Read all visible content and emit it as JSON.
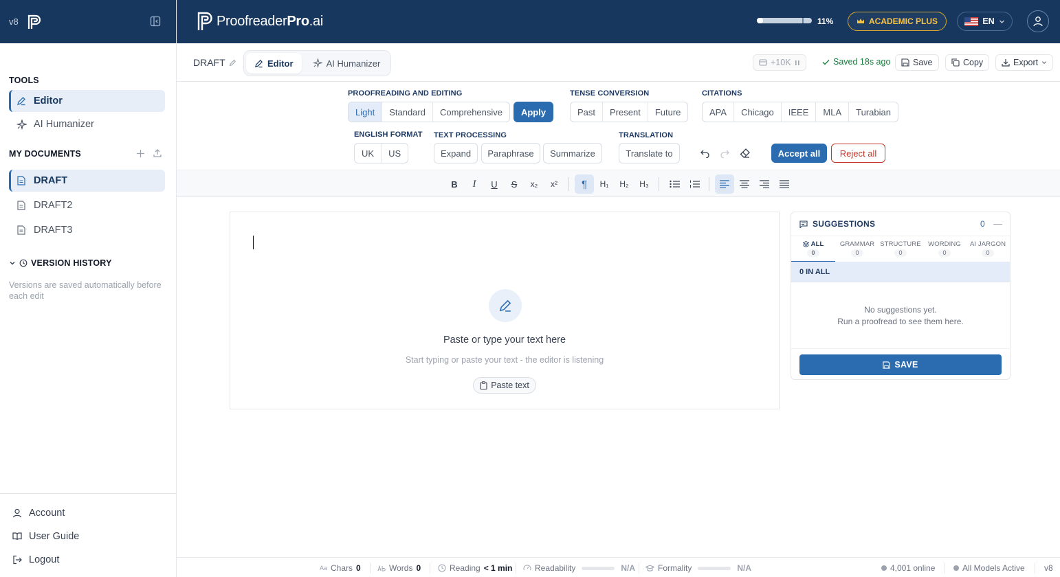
{
  "sidebar": {
    "version": "v8",
    "tools_title": "TOOLS",
    "tools": [
      {
        "label": "Editor",
        "icon": "pencil-icon"
      },
      {
        "label": "AI Humanizer",
        "icon": "sparkle-icon"
      }
    ],
    "docs_title": "MY DOCUMENTS",
    "documents": [
      {
        "label": "DRAFT"
      },
      {
        "label": "DRAFT2"
      },
      {
        "label": "DRAFT3"
      }
    ],
    "history_title": "VERSION HISTORY",
    "history_note": "Versions are saved automatically before each edit",
    "bottom_links": [
      {
        "label": "Account",
        "icon": "user-icon"
      },
      {
        "label": "User Guide",
        "icon": "book-icon"
      },
      {
        "label": "Logout",
        "icon": "logout-icon"
      }
    ]
  },
  "header": {
    "brand_light": "Proofreader",
    "brand_bold": "Pro",
    "brand_suffix": ".ai",
    "usage_percent": 11,
    "usage_label": "11%",
    "plan_label": "ACADEMIC PLUS",
    "language": "EN",
    "colors": {
      "navy": "#17375e",
      "accent": "#2b6cb0",
      "gold": "#f6c343"
    }
  },
  "docbar": {
    "doc_name": "DRAFT",
    "tabs": [
      {
        "label": "Editor",
        "icon": "pencil-icon"
      },
      {
        "label": "AI Humanizer",
        "icon": "sparkle-icon"
      }
    ],
    "tokens": "+10K",
    "saved_status": "Saved 18s ago",
    "save_label": "Save",
    "copy_label": "Copy",
    "export_label": "Export"
  },
  "tools": {
    "proofreading": {
      "label": "PROOFREADING AND EDITING",
      "options": [
        "Light",
        "Standard",
        "Comprehensive"
      ],
      "selected": "Light",
      "apply": "Apply"
    },
    "tense": {
      "label": "TENSE CONVERSION",
      "options": [
        "Past",
        "Present",
        "Future"
      ]
    },
    "citations": {
      "label": "CITATIONS",
      "options": [
        "APA",
        "Chicago",
        "IEEE",
        "MLA",
        "Turabian"
      ]
    },
    "english": {
      "label": "ENGLISH FORMAT",
      "options": [
        "UK",
        "US"
      ]
    },
    "text_processing": {
      "label": "TEXT PROCESSING",
      "options": [
        "Expand",
        "Paraphrase",
        "Summarize"
      ]
    },
    "translation": {
      "label": "TRANSLATION",
      "button": "Translate to"
    },
    "accept_all": "Accept all",
    "reject_all": "Reject all"
  },
  "format_toolbar": {
    "buttons": [
      "bold-icon",
      "italic-icon",
      "underline-icon",
      "strikethrough-icon",
      "subscript-icon",
      "superscript-icon",
      "paragraph-icon",
      "heading-1-icon",
      "heading-2-icon",
      "heading-3-icon",
      "bullet-list-icon",
      "numbered-list-icon",
      "align-left-icon",
      "align-center-icon",
      "align-right-icon",
      "align-justify-icon"
    ],
    "glyphs": {
      "bold": "B",
      "italic": "I",
      "underline": "U",
      "strike": "S",
      "sub": "x₂",
      "sup": "x²",
      "para": "¶",
      "h1": "H₁",
      "h2": "H₂",
      "h3": "H₃"
    }
  },
  "editor": {
    "empty_title": "Paste or type your text here",
    "empty_sub": "Start typing or paste your text - the editor is listening",
    "paste_label": "Paste text"
  },
  "suggestions": {
    "title": "SUGGESTIONS",
    "count": "0",
    "tabs": [
      {
        "label": "ALL",
        "count": "0"
      },
      {
        "label": "GRAMMAR",
        "count": "0"
      },
      {
        "label": "STRUCTURE",
        "count": "0"
      },
      {
        "label": "WORDING",
        "count": "0"
      },
      {
        "label": "AI JARGON",
        "count": "0"
      }
    ],
    "filter_label": "0 IN ALL",
    "empty_line1": "No suggestions yet.",
    "empty_line2": "Run a proofread to see them here.",
    "save_label": "SAVE"
  },
  "status": {
    "chars_label": "Chars",
    "chars": "0",
    "words_label": "Words",
    "words": "0",
    "reading_label": "Reading",
    "reading": "< 1 min",
    "readability_label": "Readability",
    "readability": "N/A",
    "formality_label": "Formality",
    "formality": "N/A",
    "online": "4,001 online",
    "models": "All Models Active",
    "version": "v8"
  }
}
